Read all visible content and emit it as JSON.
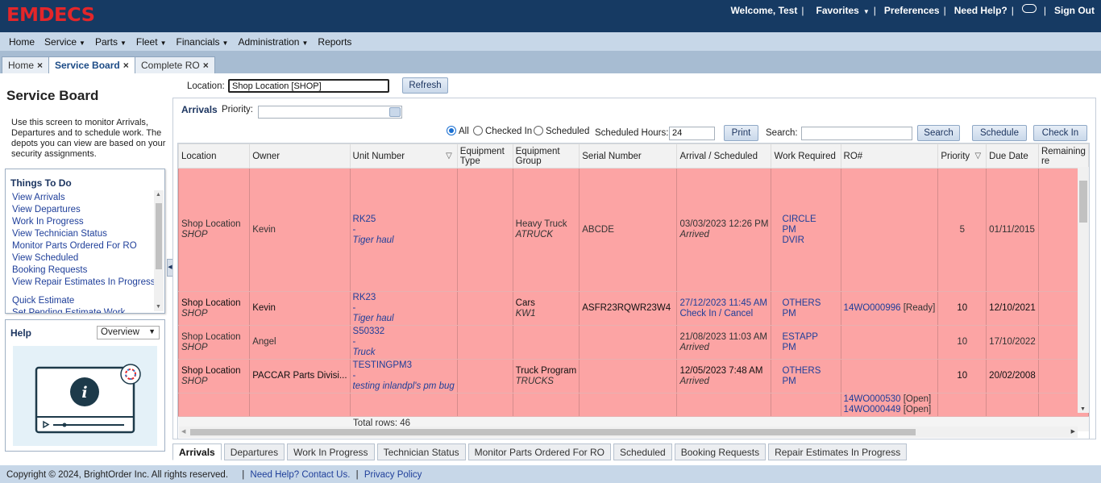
{
  "app": {
    "logo_text": "EMDECS",
    "brand_color": "#e3262a",
    "header_bg": "#163a63"
  },
  "user_menu": {
    "welcome": "Welcome, Test",
    "favorites": "Favorites",
    "preferences": "Preferences",
    "help": "Need Help?",
    "sign_out": "Sign Out"
  },
  "nav": [
    "Home",
    "Service",
    "Parts",
    "Fleet",
    "Financials",
    "Administration",
    "Reports"
  ],
  "page_tabs": [
    {
      "label": "Home"
    },
    {
      "label": "Service Board"
    },
    {
      "label": "Complete RO"
    }
  ],
  "sidebar": {
    "title": "Service Board",
    "description": "Use this screen to monitor Arrivals, Departures and to schedule work. The depots you can view are based on your security assignments.",
    "todo_title": "Things To Do",
    "todo_items": [
      "View Arrivals",
      "View Departures",
      "Work In Progress",
      "View Technician Status",
      "Monitor Parts Ordered For RO",
      "View Scheduled",
      "Booking Requests",
      "View Repair Estimates In Progress"
    ],
    "todo_items_after_gap": [
      "Quick Estimate",
      "Set Pending Estimate Work"
    ],
    "help_title": "Help",
    "help_select": "Overview"
  },
  "filters": {
    "location_label": "Location:",
    "location_value": "Shop Location [SHOP]",
    "refresh": "Refresh",
    "priority_label": "Priority:",
    "priority_value": ""
  },
  "arrivals": {
    "title": "Arrivals",
    "radio_all": "All",
    "radio_checked_in": "Checked In",
    "radio_scheduled": "Scheduled",
    "scheduled_hours_label": "Scheduled Hours:",
    "scheduled_hours_value": "24",
    "print": "Print",
    "search_label": "Search:",
    "search_value": "",
    "search_button": "Search",
    "schedule_button": "Schedule",
    "checkin_button": "Check In"
  },
  "grid": {
    "columns": [
      "Location",
      "Owner",
      "Unit Number",
      "Equipment Type",
      "Equipment Group",
      "Serial Number",
      "Arrival / Scheduled",
      "Work Required",
      "RO#",
      "Priority",
      "Due Date",
      "Remaining re"
    ],
    "rows": [
      {
        "location": "Shop Location",
        "location_code": "SHOP",
        "owner": "Kevin",
        "unit": "RK25",
        "unit_dash": "-",
        "unit_desc": "Tiger haul",
        "eq_type": "",
        "eq_group": "Heavy Truck",
        "eq_group_code": "ATRUCK",
        "serial": "ABCDE",
        "arrival": "03/03/2023 12:26 PM",
        "arrival_status": "Arrived",
        "work1": "CIRCLE",
        "work2": "PM",
        "work3": "DVIR",
        "ro": "",
        "ro_status": "",
        "priority": "5",
        "due": "01/11/2015"
      },
      {
        "location": "Shop Location",
        "location_code": "SHOP",
        "owner": "Kevin",
        "unit": "RK23",
        "unit_dash": "-",
        "unit_desc": "Tiger haul",
        "eq_type": "",
        "eq_group": "Cars",
        "eq_group_code": "KW1",
        "serial": "ASFR23RQWR23W4",
        "arrival": "27/12/2023 11:45 AM",
        "arrival_status": "Check In  /  Cancel",
        "work1": "OTHERS",
        "work2": "PM",
        "work3": "",
        "ro": "14WO000996",
        "ro_status": "[Ready]",
        "priority": "10",
        "due": "12/10/2021"
      },
      {
        "location": "Shop Location",
        "location_code": "SHOP",
        "owner": "Angel",
        "unit": "S50332",
        "unit_dash": "-",
        "unit_desc": "Truck",
        "eq_type": "",
        "eq_group": "",
        "eq_group_code": "",
        "serial": "",
        "arrival": "21/08/2023 11:03 AM",
        "arrival_status": "Arrived",
        "work1": "ESTAPP",
        "work2": "PM",
        "work3": "",
        "ro": "",
        "ro_status": "",
        "priority": "10",
        "due": "17/10/2022"
      },
      {
        "location": "Shop Location",
        "location_code": "SHOP",
        "owner": "PACCAR Parts Divisi...",
        "unit": "TESTINGPM3",
        "unit_dash": "-",
        "unit_desc": "testing inlandpl's pm bug",
        "eq_type": "",
        "eq_group": "Truck Program",
        "eq_group_code": "TRUCKS",
        "serial": "",
        "arrival": "12/05/2023 7:48 AM",
        "arrival_status": "Arrived",
        "work1": "OTHERS",
        "work2": "PM",
        "work3": "",
        "ro": "",
        "ro_status": "",
        "priority": "10",
        "due": "20/02/2008"
      },
      {
        "ro": "14WO000530",
        "ro_status": "[Open]",
        "ro2": "14WO000449",
        "ro2_status": "[Open]"
      }
    ],
    "total_rows_label": "Total rows:",
    "total_rows": "46"
  },
  "bottom_tabs": [
    "Arrivals",
    "Departures",
    "Work In Progress",
    "Technician Status",
    "Monitor Parts Ordered For RO",
    "Scheduled",
    "Booking Requests",
    "Repair Estimates In Progress"
  ],
  "footer": {
    "copyright": "Copyright © 2024, BrightOrder Inc. All rights reserved.",
    "help_link": "Need Help? Contact Us.",
    "privacy_link": "Privacy Policy"
  },
  "colors": {
    "row_highlight": "#fca4a4",
    "nav_bg": "#c7d7e8",
    "tab_bar_bg": "#a7bcd2"
  }
}
